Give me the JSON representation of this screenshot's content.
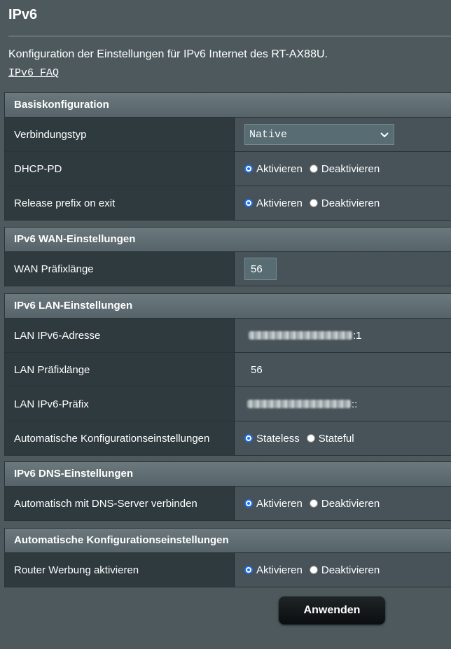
{
  "page": {
    "title": "IPv6",
    "intro": "Konfiguration der Einstellungen für IPv6 Internet des RT-AX88U.",
    "faq_link": "IPv6 FAQ"
  },
  "basic": {
    "header": "Basiskonfiguration",
    "connection_type_label": "Verbindungstyp",
    "connection_type_value": "Native",
    "dhcp_pd_label": "DHCP-PD",
    "dhcp_pd_on": "Aktivieren",
    "dhcp_pd_off": "Deaktivieren",
    "release_label": "Release prefix on exit",
    "release_on": "Aktivieren",
    "release_off": "Deaktivieren"
  },
  "wan": {
    "header": "IPv6 WAN-Einstellungen",
    "prefix_len_label": "WAN Präfixlänge",
    "prefix_len_value": "56"
  },
  "lan": {
    "header": "IPv6 LAN-Einstellungen",
    "address_label": "LAN IPv6-Adresse",
    "address_suffix": ":1",
    "prefix_len_label": "LAN Präfixlänge",
    "prefix_len_value": "56",
    "prefix_label": "LAN IPv6-Präfix",
    "prefix_suffix": "::",
    "autoconf_label": "Automatische Konfigurationseinstellungen",
    "autoconf_stateless": "Stateless",
    "autoconf_stateful": "Stateful"
  },
  "dns": {
    "header": "IPv6 DNS-Einstellungen",
    "auto_label": "Automatisch mit DNS-Server verbinden",
    "auto_on": "Aktivieren",
    "auto_off": "Deaktivieren"
  },
  "autoconfig": {
    "header": "Automatische Konfigurationseinstellungen",
    "router_adv_label": "Router Werbung aktivieren",
    "router_adv_on": "Aktivieren",
    "router_adv_off": "Deaktivieren"
  },
  "actions": {
    "apply_label": "Anwenden"
  },
  "colors": {
    "background": "#4d595d",
    "label_cell": "#2f3a3e",
    "value_cell": "#475359",
    "radio_accent": "#1e6fe8"
  }
}
